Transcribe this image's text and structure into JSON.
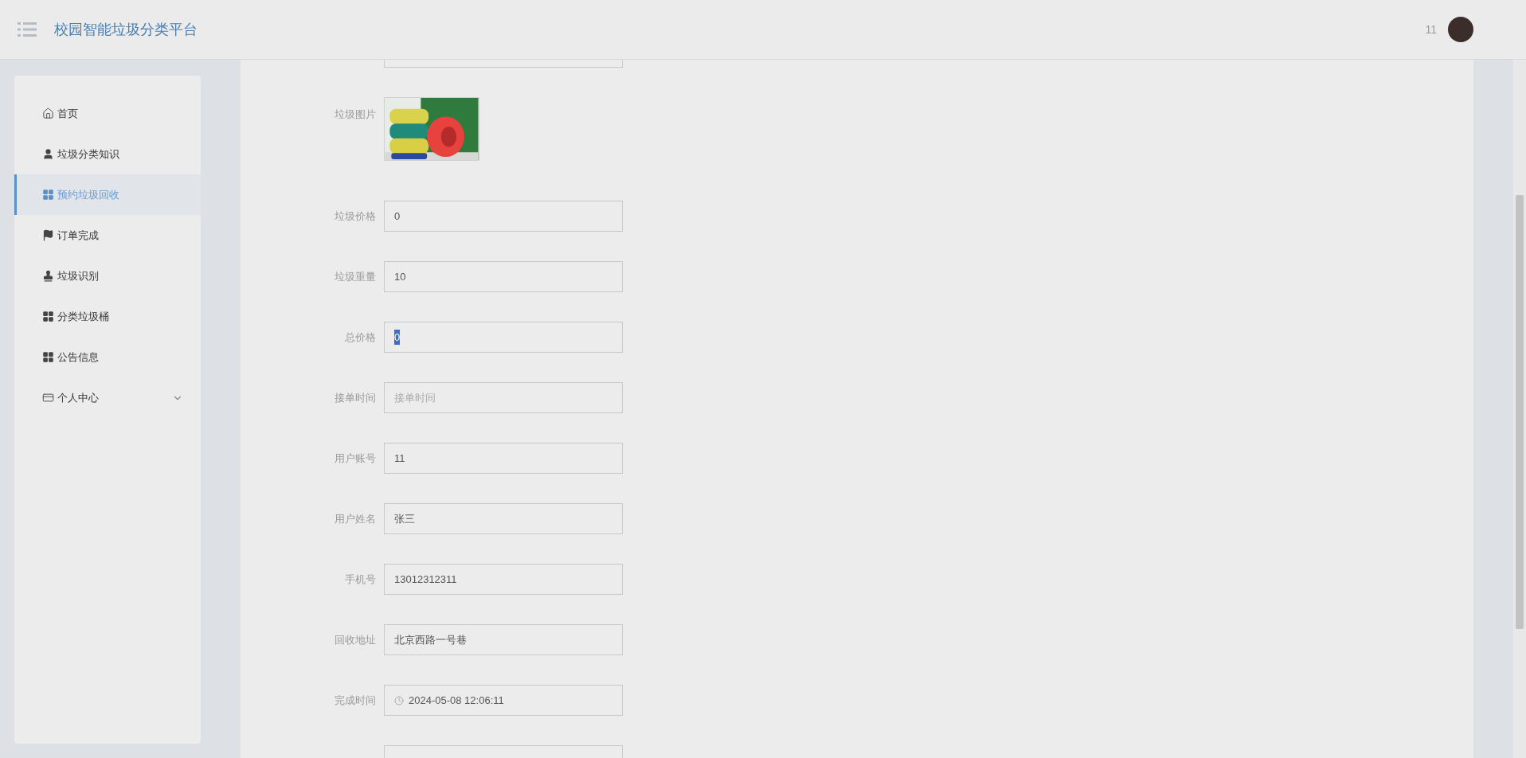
{
  "header": {
    "title": "校园智能垃圾分类平台",
    "user": "11"
  },
  "sidebar": {
    "items": [
      {
        "label": "首页",
        "kind": "home",
        "selected": false
      },
      {
        "label": "垃圾分类知识",
        "kind": "user",
        "selected": false
      },
      {
        "label": "预约垃圾回收",
        "kind": "grid",
        "selected": true
      },
      {
        "label": "订单完成",
        "kind": "flag",
        "selected": false
      },
      {
        "label": "垃圾识别",
        "kind": "stamp",
        "selected": false
      },
      {
        "label": "分类垃圾桶",
        "kind": "grid",
        "selected": false
      },
      {
        "label": "公告信息",
        "kind": "grid",
        "selected": false
      },
      {
        "label": "个人中心",
        "kind": "card",
        "selected": false,
        "expandable": true
      }
    ]
  },
  "form": {
    "fields": [
      {
        "label": "垃圾图片"
      },
      {
        "kind": "text",
        "label": "垃圾价格",
        "value": "0"
      },
      {
        "kind": "text",
        "label": "垃圾重量",
        "value": "10"
      },
      {
        "kind": "text",
        "label": "总价格",
        "value": "0",
        "highlighted": true
      },
      {
        "kind": "text",
        "label": "接单时间",
        "placeholder": "接单时间"
      },
      {
        "kind": "text",
        "label": "用户账号",
        "value": "11"
      },
      {
        "kind": "text",
        "label": "用户姓名",
        "value": "张三"
      },
      {
        "kind": "text",
        "label": "手机号",
        "value": "13012312311"
      },
      {
        "kind": "text",
        "label": "回收地址",
        "value": "北京西路一号巷"
      },
      {
        "kind": "datetime",
        "label": "完成时间",
        "value": "2024-05-08 12:06:11"
      }
    ]
  }
}
